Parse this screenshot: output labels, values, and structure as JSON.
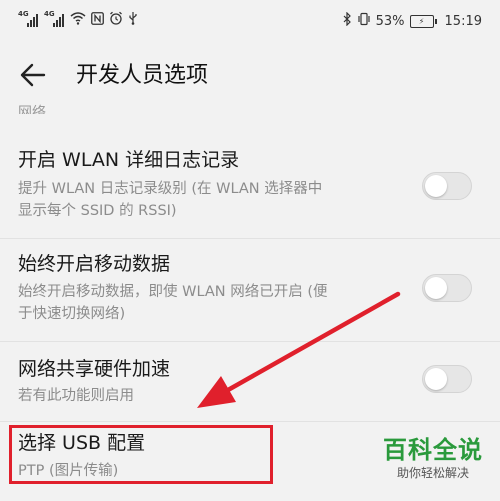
{
  "status_bar": {
    "signal1_label": "4G",
    "signal2_label": "4G",
    "battery_percent": "53%",
    "time": "15:19"
  },
  "header": {
    "title": "开发人员选项"
  },
  "partial_section": "网络",
  "settings": [
    {
      "title": "开启 WLAN 详细日志记录",
      "subtitle_line1": "提升 WLAN 日志记录级别 (在 WLAN 选择器中",
      "subtitle_line2": "显示每个 SSID 的 RSSI)",
      "enabled": false
    },
    {
      "title": "始终开启移动数据",
      "subtitle_line1": "始终开启移动数据，即使 WLAN 网络已开启 (便",
      "subtitle_line2": "于快速切换网络)",
      "enabled": false
    },
    {
      "title": "网络共享硬件加速",
      "subtitle_line1": "若有此功能则启用",
      "enabled": false
    },
    {
      "title": "选择 USB 配置",
      "subtitle_line1": "PTP (图片传输)"
    }
  ],
  "watermark": {
    "main": "百科全说",
    "sub": "助你轻松解决"
  },
  "colors": {
    "highlight": "#e0202c",
    "watermark": "#2a9a3c"
  }
}
